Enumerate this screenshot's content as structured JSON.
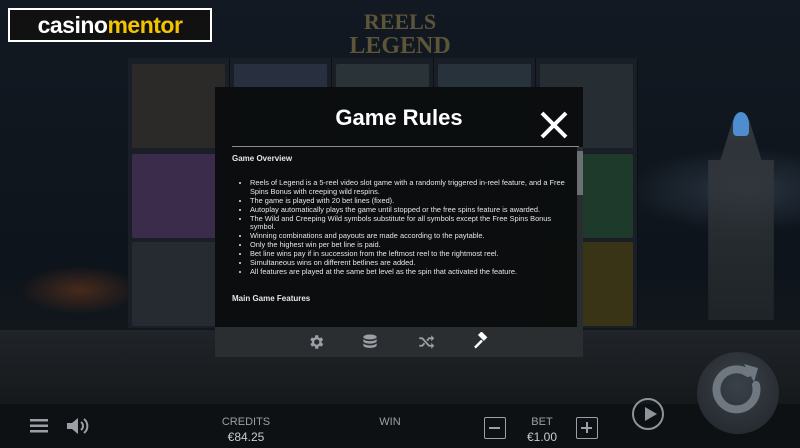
{
  "branding": {
    "logo_part1": "casino",
    "logo_part2": "mentor",
    "game_title_line1": "REELS",
    "game_title_line2": "LEGEND"
  },
  "dialog": {
    "title": "Game Rules",
    "overview_heading": "Game Overview",
    "rules": [
      "Reels of Legend is a 5-reel video slot game with a randomly triggered in-reel feature, and a Free Spins Bonus with creeping wild respins.",
      "The game is played with 20 bet lines (fixed).",
      "Autoplay automatically plays the game until stopped or the free spins feature is awarded.",
      "The Wild and Creeping Wild symbols substitute for all symbols except the Free Spins Bonus symbol.",
      "Winning combinations and payouts are made according to the paytable.",
      "Only the highest win per bet line is paid.",
      "Bet line wins pay if in succession from the leftmost reel to the rightmost reel.",
      "Simultaneous wins on different betlines are added.",
      "All features are played at the same bet level as the spin that activated the feature."
    ],
    "features_heading": "Main Game Features",
    "tabs": [
      {
        "icon": "gear-icon",
        "active": false
      },
      {
        "icon": "coins-icon",
        "active": false
      },
      {
        "icon": "shuffle-icon",
        "active": false
      },
      {
        "icon": "gavel-icon",
        "active": true
      }
    ]
  },
  "bottom_bar": {
    "credits_label": "CREDITS",
    "credits_value": "€84.25",
    "win_label": "WIN",
    "bet_label": "BET",
    "bet_value": "€1.00"
  },
  "colors": {
    "accent_logo": "#f5c400",
    "dialog_bg": "#0a0c0e",
    "tabbar_bg": "#2b2e31"
  }
}
